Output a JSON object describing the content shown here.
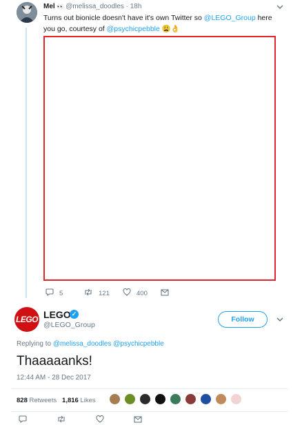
{
  "reply": {
    "name": "Mel",
    "name_emoji": "👀",
    "handle": "@melissa_doodles",
    "time": "18h",
    "text_before": "Turns out bionicle doesn't have it's own Twitter so ",
    "mention_lego": "@LEGO_Group",
    "text_mid": " here you go, courtesy of ",
    "mention_pebble": "@psychicpebble",
    "text_emoji": "😩👌",
    "replies": "5",
    "retweets": "121",
    "likes": "400"
  },
  "tweet": {
    "logo_text": "LEGO",
    "name": "LEGO",
    "verified_mark": "✓",
    "handle": "@LEGO_Group",
    "follow_label": "Follow",
    "replying_prefix": "Replying to ",
    "replying_to": "@melissa_doodles @psychicpebble",
    "text": "Thaaaaanks!",
    "timestamp": "12:44 AM - 28 Dec 2017",
    "retweet_count": "828",
    "retweet_label": "Retweets",
    "like_count": "1,816",
    "like_label": "Likes"
  },
  "icons": {
    "reply": "reply-icon",
    "retweet": "retweet-icon",
    "like": "heart-icon",
    "dm": "envelope-icon",
    "caret": "chevron-down-icon"
  },
  "colors": {
    "link": "#1da1f2",
    "lego_red": "#d01012",
    "highlight_border": "#e3242b"
  }
}
